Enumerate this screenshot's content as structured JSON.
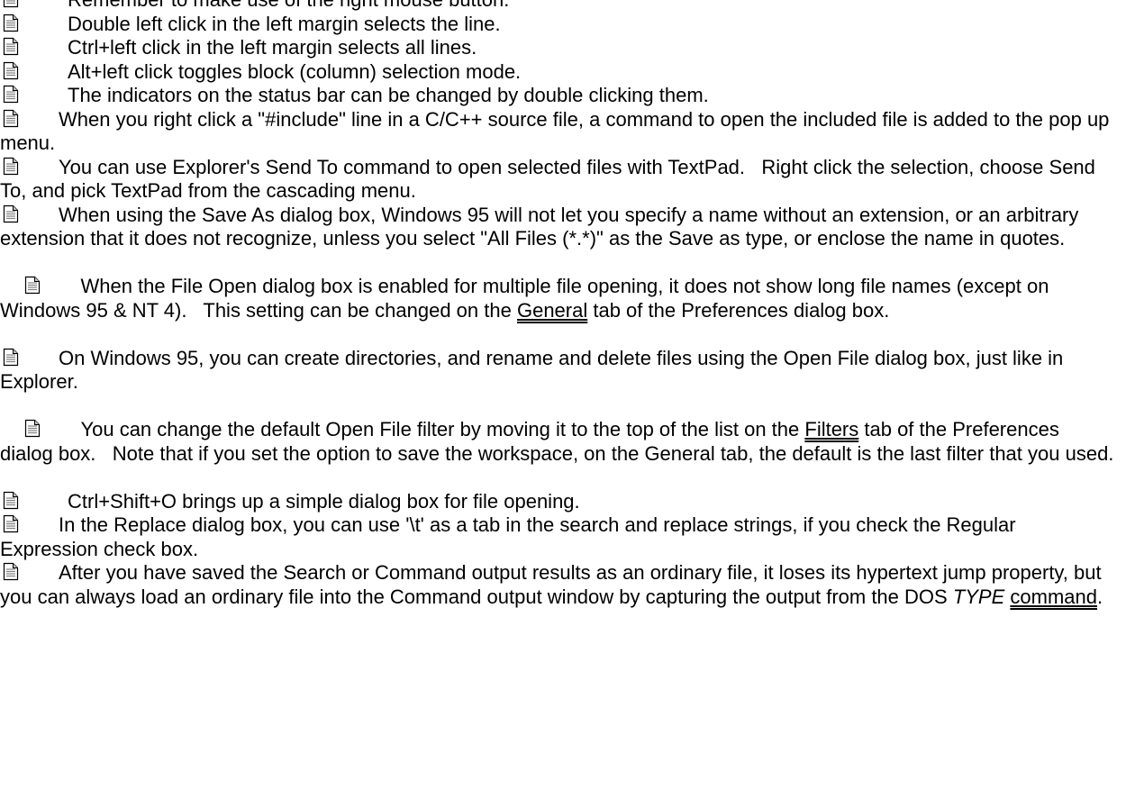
{
  "window": {
    "title": ""
  },
  "tips": [
    {
      "text": "Remember to make use of the right mouse button.",
      "single": true
    },
    {
      "text": "Double left click in the left margin selects the line.",
      "single": true
    },
    {
      "text": "Ctrl+left click in the left margin selects all lines.",
      "single": true
    },
    {
      "text": "Alt+left click toggles block (column) selection mode.",
      "single": true
    },
    {
      "text": "The indicators on the status bar can be changed by double clicking them.",
      "single": true
    },
    {
      "text": "When you right click a \"#include\" line in a C/C++ source file, a command to open the included file is added to the pop up menu."
    },
    {
      "text": "You can use Explorer's Send To command to open selected files with TextPad.   Right click the selection, choose Send To, and pick TextPad from the cascading menu."
    },
    {
      "text": "When using the Save As dialog box, Windows 95 will not let you specify a name without an extension, or an arbitrary extension that it does not recognize, unless you select \"All Files (*.*)\" as the Save as type, or enclose the name in quotes."
    },
    {
      "before": "When the File Open dialog box is enabled for multiple file opening, it does not show long file names (except on Windows 95 & NT 4).   This setting can be changed on the ",
      "link": "General",
      "after": " tab of the Preferences dialog box."
    },
    {
      "text": "On Windows 95, you can create directories, and rename and delete files using the Open File dialog box, just like in Explorer."
    },
    {
      "before": "You can change the default Open File filter by moving it to the top of the list on the ",
      "link": "Filters",
      "after": " tab of the Preferences dialog box.   Note that if you set the option to save the workspace, on the General tab, the default is the last filter that you used."
    },
    {
      "text": "Ctrl+Shift+O brings up a simple dialog box for file opening.",
      "single": true
    },
    {
      "text": "In the Replace dialog box, you can use '\\t' as a tab in the search and replace strings, if you check the Regular Expression check box."
    },
    {
      "before": "After you have saved the Search or Command output results as an ordinary file, it loses its hypertext jump property, but you can always load an ordinary file into the Command output window by capturing the output from the DOS ",
      "italic": "TYPE",
      "space": " ",
      "link": "command",
      "after": "."
    }
  ],
  "icon": {
    "name": "document-icon",
    "fill": "#ffffff",
    "border": "#000000",
    "lines": "#808080",
    "shade": "#c0c0c0"
  }
}
